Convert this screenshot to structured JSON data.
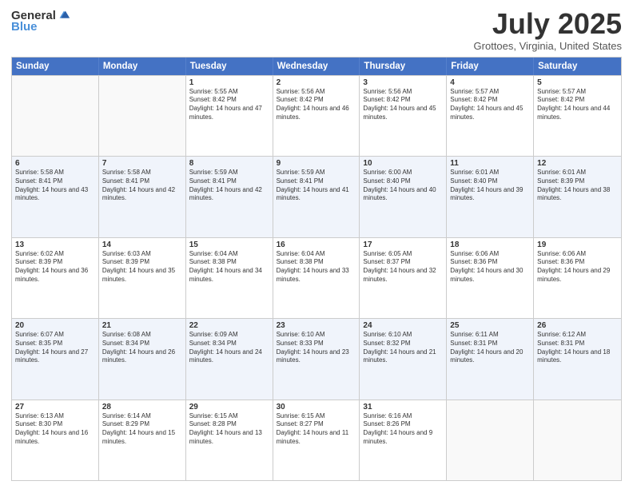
{
  "header": {
    "logo_general": "General",
    "logo_blue": "Blue",
    "month_title": "July 2025",
    "location": "Grottoes, Virginia, United States"
  },
  "days_of_week": [
    "Sunday",
    "Monday",
    "Tuesday",
    "Wednesday",
    "Thursday",
    "Friday",
    "Saturday"
  ],
  "weeks": [
    [
      {
        "day": "",
        "empty": true
      },
      {
        "day": "",
        "empty": true
      },
      {
        "day": "1",
        "sunrise": "5:55 AM",
        "sunset": "8:42 PM",
        "daylight": "14 hours and 47 minutes."
      },
      {
        "day": "2",
        "sunrise": "5:56 AM",
        "sunset": "8:42 PM",
        "daylight": "14 hours and 46 minutes."
      },
      {
        "day": "3",
        "sunrise": "5:56 AM",
        "sunset": "8:42 PM",
        "daylight": "14 hours and 45 minutes."
      },
      {
        "day": "4",
        "sunrise": "5:57 AM",
        "sunset": "8:42 PM",
        "daylight": "14 hours and 45 minutes."
      },
      {
        "day": "5",
        "sunrise": "5:57 AM",
        "sunset": "8:42 PM",
        "daylight": "14 hours and 44 minutes."
      }
    ],
    [
      {
        "day": "6",
        "sunrise": "5:58 AM",
        "sunset": "8:41 PM",
        "daylight": "14 hours and 43 minutes."
      },
      {
        "day": "7",
        "sunrise": "5:58 AM",
        "sunset": "8:41 PM",
        "daylight": "14 hours and 42 minutes."
      },
      {
        "day": "8",
        "sunrise": "5:59 AM",
        "sunset": "8:41 PM",
        "daylight": "14 hours and 42 minutes."
      },
      {
        "day": "9",
        "sunrise": "5:59 AM",
        "sunset": "8:41 PM",
        "daylight": "14 hours and 41 minutes."
      },
      {
        "day": "10",
        "sunrise": "6:00 AM",
        "sunset": "8:40 PM",
        "daylight": "14 hours and 40 minutes."
      },
      {
        "day": "11",
        "sunrise": "6:01 AM",
        "sunset": "8:40 PM",
        "daylight": "14 hours and 39 minutes."
      },
      {
        "day": "12",
        "sunrise": "6:01 AM",
        "sunset": "8:39 PM",
        "daylight": "14 hours and 38 minutes."
      }
    ],
    [
      {
        "day": "13",
        "sunrise": "6:02 AM",
        "sunset": "8:39 PM",
        "daylight": "14 hours and 36 minutes."
      },
      {
        "day": "14",
        "sunrise": "6:03 AM",
        "sunset": "8:39 PM",
        "daylight": "14 hours and 35 minutes."
      },
      {
        "day": "15",
        "sunrise": "6:04 AM",
        "sunset": "8:38 PM",
        "daylight": "14 hours and 34 minutes."
      },
      {
        "day": "16",
        "sunrise": "6:04 AM",
        "sunset": "8:38 PM",
        "daylight": "14 hours and 33 minutes."
      },
      {
        "day": "17",
        "sunrise": "6:05 AM",
        "sunset": "8:37 PM",
        "daylight": "14 hours and 32 minutes."
      },
      {
        "day": "18",
        "sunrise": "6:06 AM",
        "sunset": "8:36 PM",
        "daylight": "14 hours and 30 minutes."
      },
      {
        "day": "19",
        "sunrise": "6:06 AM",
        "sunset": "8:36 PM",
        "daylight": "14 hours and 29 minutes."
      }
    ],
    [
      {
        "day": "20",
        "sunrise": "6:07 AM",
        "sunset": "8:35 PM",
        "daylight": "14 hours and 27 minutes."
      },
      {
        "day": "21",
        "sunrise": "6:08 AM",
        "sunset": "8:34 PM",
        "daylight": "14 hours and 26 minutes."
      },
      {
        "day": "22",
        "sunrise": "6:09 AM",
        "sunset": "8:34 PM",
        "daylight": "14 hours and 24 minutes."
      },
      {
        "day": "23",
        "sunrise": "6:10 AM",
        "sunset": "8:33 PM",
        "daylight": "14 hours and 23 minutes."
      },
      {
        "day": "24",
        "sunrise": "6:10 AM",
        "sunset": "8:32 PM",
        "daylight": "14 hours and 21 minutes."
      },
      {
        "day": "25",
        "sunrise": "6:11 AM",
        "sunset": "8:31 PM",
        "daylight": "14 hours and 20 minutes."
      },
      {
        "day": "26",
        "sunrise": "6:12 AM",
        "sunset": "8:31 PM",
        "daylight": "14 hours and 18 minutes."
      }
    ],
    [
      {
        "day": "27",
        "sunrise": "6:13 AM",
        "sunset": "8:30 PM",
        "daylight": "14 hours and 16 minutes."
      },
      {
        "day": "28",
        "sunrise": "6:14 AM",
        "sunset": "8:29 PM",
        "daylight": "14 hours and 15 minutes."
      },
      {
        "day": "29",
        "sunrise": "6:15 AM",
        "sunset": "8:28 PM",
        "daylight": "14 hours and 13 minutes."
      },
      {
        "day": "30",
        "sunrise": "6:15 AM",
        "sunset": "8:27 PM",
        "daylight": "14 hours and 11 minutes."
      },
      {
        "day": "31",
        "sunrise": "6:16 AM",
        "sunset": "8:26 PM",
        "daylight": "14 hours and 9 minutes."
      },
      {
        "day": "",
        "empty": true
      },
      {
        "day": "",
        "empty": true
      }
    ]
  ],
  "labels": {
    "sunrise": "Sunrise:",
    "sunset": "Sunset:",
    "daylight": "Daylight:"
  }
}
